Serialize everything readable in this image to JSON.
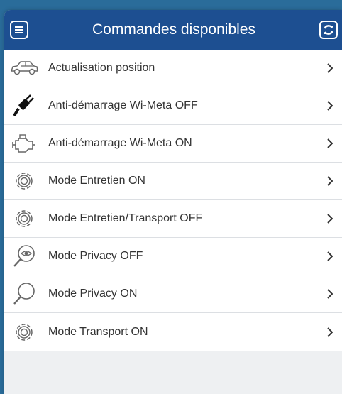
{
  "header": {
    "title": "Commandes disponibles"
  },
  "colors": {
    "header": "#1d4f91",
    "accent_border": "#2a6c9a"
  },
  "commands": [
    {
      "label": "Actualisation position",
      "icon": "car-icon"
    },
    {
      "label": "Anti-démarrage Wi-Meta OFF",
      "icon": "plug-icon"
    },
    {
      "label": "Anti-démarrage Wi-Meta ON",
      "icon": "engine-icon"
    },
    {
      "label": "Mode Entretien ON",
      "icon": "gear-icon"
    },
    {
      "label": "Mode Entretien/Transport OFF",
      "icon": "gear-icon"
    },
    {
      "label": "Mode Privacy OFF",
      "icon": "eye-magnifier-icon"
    },
    {
      "label": "Mode Privacy ON",
      "icon": "magnifier-icon"
    },
    {
      "label": "Mode Transport ON",
      "icon": "gear-icon"
    }
  ]
}
